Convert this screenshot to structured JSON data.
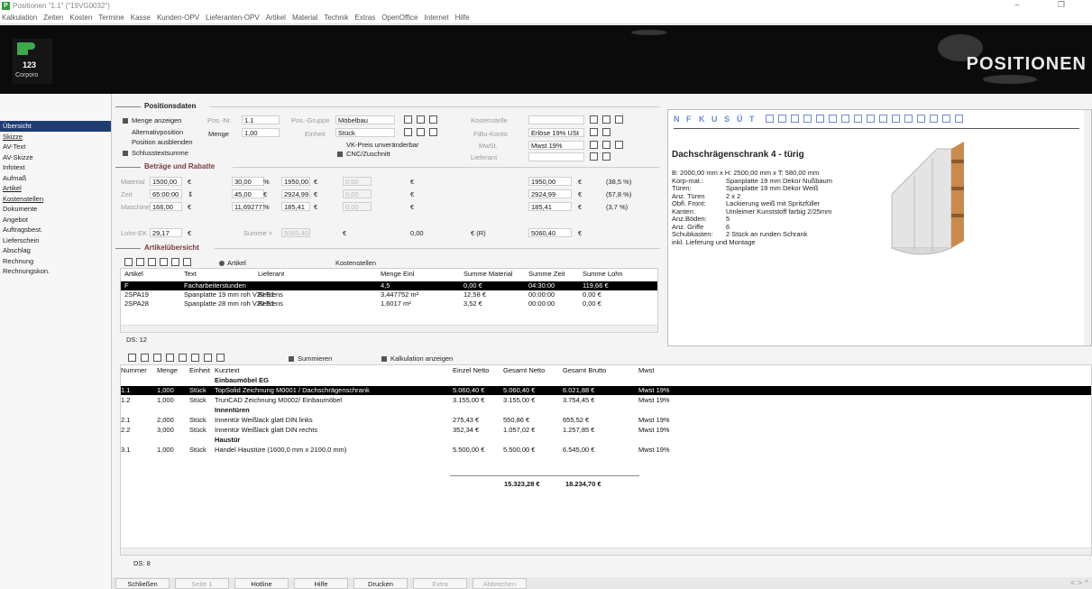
{
  "window": {
    "title": "Positionen \"1.1\" (\"19VG0032\")",
    "controls": "–  ❐"
  },
  "menu": [
    "Kalkulation",
    "Zeiten",
    "Kosten",
    "Termine",
    "Kasse",
    "Kunden-OPV",
    "Lieferanten-OPV",
    "Artikel",
    "Material",
    "Technik",
    "Extras",
    "OpenOffice",
    "Internet",
    "Hilfe"
  ],
  "logo": {
    "number": "123",
    "caption": "Corporo"
  },
  "brand": "POSITIONEN",
  "nav": [
    {
      "label": "Übersicht",
      "sel": true
    },
    {
      "label": "Skizze",
      "u": true
    },
    {
      "label": "AV-Text"
    },
    {
      "label": "AV-Skizze"
    },
    {
      "label": "Infotext"
    },
    {
      "label": "Aufmaß"
    },
    {
      "label": "Artikel",
      "u": true
    },
    {
      "label": "Kostenstellen",
      "u": true
    },
    {
      "label": "Dokumente"
    },
    {
      "label": "Angebot"
    },
    {
      "label": "Auftragsbest."
    },
    {
      "label": "Lieferschein"
    },
    {
      "label": "Abschlag"
    },
    {
      "label": "Rechnung"
    },
    {
      "label": "Rechnungskon."
    }
  ],
  "pos": {
    "section": "Positionsdaten",
    "menge_anzeigen": "Menge anzeigen",
    "alternativposition": "Alternativposition",
    "position_ausblenden": "Position ausblenden",
    "schlusstextsumme": "Schlusstextsumme",
    "posnr_label": "Pos.-Nr.",
    "posnr": "1.1",
    "menge_label": "Menge",
    "menge": "1,00",
    "einheit_label": "Einheit",
    "einheit": "Stück",
    "gruppe_label": "Pos.-Gruppe",
    "gruppe": "Möbelbau",
    "vk_preis": "VK-Preis unveränderbar",
    "cnc": "CNC/Zuschnitt",
    "kostenstelle_label": "Kostenstelle",
    "fibu_label": "FiBu-Konto",
    "fibu": "Erlöse 19% USt",
    "mwst_label": "MwSt.",
    "mwst": "Mwst 19%",
    "lieferant_label": "Lieferant"
  },
  "betraege": {
    "section": "Beträge und Rabatte",
    "rows": [
      {
        "label": "Material",
        "v1": "1500,00",
        "u1": "€",
        "v2": "30,00",
        "u2": "%",
        "v3": "1950,00",
        "u3": "€",
        "v4": "0,00",
        "u4": "€",
        "v5": "1950,00",
        "u5": "€",
        "pct": "(38,5 %)"
      },
      {
        "label": "Zeit",
        "v1": "65:00:00",
        "u1": "⇕",
        "v2": "45,00",
        "u2": "€",
        "v3": "2924,99",
        "u3": "€",
        "v4": "0,00",
        "u4": "€",
        "v5": "2924,99",
        "u5": "€",
        "pct": "(57,8 %)"
      },
      {
        "label": "Maschine",
        "v1": "166,00",
        "u1": "€",
        "v2": "11,692771",
        "u2": "%",
        "v3": "185,41",
        "u3": "€",
        "v4": "0,00",
        "u4": "€",
        "v5": "185,41",
        "u5": "€",
        "pct": "(3,7 %)"
      }
    ],
    "lohn_label": "Lohn-EK",
    "lohn": "29,17",
    "lohn_u": "€",
    "summe_label": "Summe =",
    "summe": "5060,40",
    "summe_u": "€",
    "rabatt": "0,00",
    "rabatt_u": "€ (R)",
    "total": "5060,40",
    "total_u": "€"
  },
  "artikel": {
    "section": "Artikelübersicht",
    "radio_artikel": "Artikel",
    "radio_kosten": "Kostenstellen",
    "headers": [
      "Artikel",
      "Text",
      "Lieferant",
      "Menge Einl",
      "Summe Material",
      "Summe Zeit",
      "Summe Lohn"
    ],
    "rows": [
      {
        "artikel": "F",
        "text": "Facharbeiterstunden",
        "lieferant": "",
        "menge": "4,5",
        "mat": "0,00 €",
        "zeit": "04:30:00",
        "lohn": "119,66 €",
        "sel": true
      },
      {
        "artikel": "2SPA19",
        "text": "Spanplatte 19 mm roh V20 E1",
        "lieferant": "Behrens",
        "menge": "3,447752 m²",
        "mat": "12,58 €",
        "zeit": "00:00:00",
        "lohn": "0,00 €"
      },
      {
        "artikel": "2SPA28",
        "text": "Spanplatte 28 mm roh V20 E1",
        "lieferant": "Behrens",
        "menge": "1,6017 m²",
        "mat": "3,52 €",
        "zeit": "00:00:00",
        "lohn": "0,00 €"
      }
    ],
    "ds": "DS: 12"
  },
  "preview": {
    "toolbar": [
      "N",
      "F",
      "K",
      "U",
      "S",
      "Ü",
      "T"
    ],
    "title": "Dachschrägenschrank  4 - türig",
    "lines": [
      "B: 2000,00 mm x H: 2500,00 mm x T: 580,00 mm",
      [
        "Korp-mat.:",
        "Spanplatte 19 mm Dekor Nußbaum"
      ],
      [
        "Türen:",
        "Spanplatte 19 mm Dekor Weiß"
      ],
      [
        "Anz. Türen",
        "2 x 2"
      ],
      [
        "Obfl. Front:",
        "Lackierung weiß mit Spritzfüller"
      ],
      [
        "Kanten:",
        "Umleimer Kunststoff farbig 2/25mm"
      ],
      [
        "Anz.Böden:",
        "5"
      ],
      [
        "Anz. Griffe",
        "6"
      ],
      [
        "Schubkasten:",
        "2 Stück an runden Schrank"
      ],
      "inkl. Lieferung und Montage"
    ]
  },
  "positions": {
    "summieren": "Summieren",
    "kalkulation": "Kalkulation anzeigen",
    "headers": [
      "Nummer",
      "Menge",
      "Einheit",
      "Kurztext",
      "Einzel Netto",
      "Gesamt Netto",
      "Gesamt Brutto",
      "Mwst"
    ],
    "rows": [
      {
        "nr": "",
        "menge": "",
        "einheit": "",
        "text": "Einbaumöbel EG",
        "group": true
      },
      {
        "nr": "1.1",
        "menge": "1,000",
        "einheit": "Stück",
        "text": "TopSolid Zeichnung M0001 / Dachschrägenschrank",
        "einzel": "5.060,40 €",
        "gesamt": "5.060,40 €",
        "brutto": "6.021,88 €",
        "mwst": "Mwst 19%",
        "sel": true
      },
      {
        "nr": "1.2",
        "menge": "1,000",
        "einheit": "Stück",
        "text": "TruriCAD Zeichnung M0002/ Einbaumöbel",
        "einzel": "3.155,00 €",
        "gesamt": "3.155,00 €",
        "brutto": "3.754,45 €",
        "mwst": "Mwst 19%"
      },
      {
        "nr": "",
        "menge": "",
        "einheit": "",
        "text": "Innentüren",
        "group": true
      },
      {
        "nr": "2.1",
        "menge": "2,000",
        "einheit": "Stück",
        "text": "Innentür Weißlack glatt DIN links",
        "einzel": "275,43 €",
        "gesamt": "550,86 €",
        "brutto": "655,52 €",
        "mwst": "Mwst 19%"
      },
      {
        "nr": "2.2",
        "menge": "3,000",
        "einheit": "Stück",
        "text": "Innentür Weißlack glatt DIN rechts",
        "einzel": "352,34 €",
        "gesamt": "1.057,02 €",
        "brutto": "1.257,85 €",
        "mwst": "Mwst 19%"
      },
      {
        "nr": "",
        "menge": "",
        "einheit": "",
        "text": "Haustür",
        "group": true
      },
      {
        "nr": "3.1",
        "menge": "1,000",
        "einheit": "Stück",
        "text": "Handel Haustüre (1600,0 mm x 2100,0 mm)",
        "einzel": "5.500,00 €",
        "gesamt": "5.500,00 €",
        "brutto": "6.545,00 €",
        "mwst": "Mwst 19%"
      }
    ],
    "total_netto": "15.323,28 €",
    "total_brutto": "18.234,70 €",
    "ds": "DS: 8"
  },
  "buttons": [
    {
      "label": "Schließen",
      "dis": false
    },
    {
      "label": "Seite 1",
      "dis": true
    },
    {
      "label": "Hotline",
      "dis": false
    },
    {
      "label": "Hilfe",
      "dis": false
    },
    {
      "label": "Drucken",
      "dis": false
    },
    {
      "label": "Extra",
      "dis": true
    },
    {
      "label": "Abbrechen",
      "dis": true
    }
  ],
  "nav_arrows": "< > ^"
}
